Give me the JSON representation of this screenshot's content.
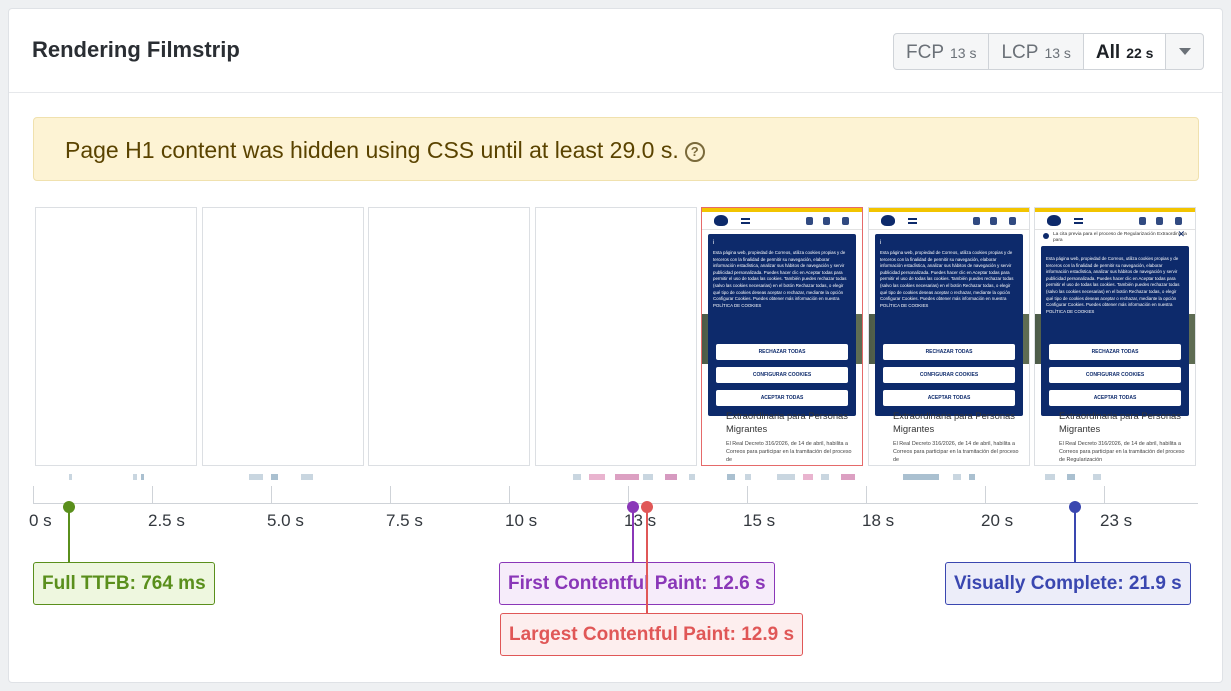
{
  "header": {
    "title": "Rendering Filmstrip"
  },
  "filter": {
    "options": [
      {
        "label": "FCP",
        "value": "13 s"
      },
      {
        "label": "LCP",
        "value": "13 s"
      },
      {
        "label": "All",
        "value": "22 s"
      }
    ],
    "selected": "All"
  },
  "warning": {
    "text": "Page H1 content was hidden using CSS until at least 29.0 s."
  },
  "frames": {
    "modal_text": "Esta página web, propiedad de Correos, utiliza cookies propias y de terceros con la finalidad de permitir su navegación, elaborar información estadística, analizar sus hábitos de navegación y servir publicidad personalizada. Puedes hacer clic en Aceptar todas para permitir el uso de todas las cookies. También puedes rechazar todas (salvo las cookies necesarias) en el botón Rechazar todas, o elegir qué tipo de cookies deseas aceptar o rechazar, mediante la opción Configurar Cookies. Puedes obtener más información en nuestra POLÍTICA DE COOKIES",
    "btn_reject": "RECHAZAR TODAS",
    "btn_config": "CONFIGURAR COOKIES",
    "btn_accept": "ACEPTAR TODAS",
    "heading": "Extraordinaria para Personas Migrantes",
    "paragraph": "El Real Decreto 316/2026, de 14 de abril, habilita a Correos para participar en la tramitación del proceso de",
    "paragraph_last": "El Real Decreto 316/2026, de 14 de abril, habilita a Correos para participar en la tramitación del proceso de Regularización",
    "cita_text": "La cita previa para el proceso de Regularización Extraordinaria para"
  },
  "axis": {
    "ticks": [
      "0 s",
      "2.5 s",
      "5.0 s",
      "7.5 s",
      "10 s",
      "13 s",
      "15 s",
      "18 s",
      "20 s",
      "23 s"
    ]
  },
  "markers": [
    {
      "key": "ttfb",
      "label": "Full TTFB: 764 ms",
      "time_s": 0.764,
      "color": "#5a8f1c",
      "bg": "#eef7df"
    },
    {
      "key": "fcp",
      "label": "First Contentful Paint: 12.6 s",
      "time_s": 12.6,
      "color": "#8a37b8",
      "bg": "#f6ecfa"
    },
    {
      "key": "lcp",
      "label": "Largest Contentful Paint: 12.9 s",
      "time_s": 12.9,
      "color": "#e05757",
      "bg": "#fdeeee"
    },
    {
      "key": "vc",
      "label": "Visually Complete: 21.9 s",
      "time_s": 21.9,
      "color": "#3a47b0",
      "bg": "#ecedf9"
    }
  ],
  "colors": {
    "accent_yellow": "#f2c400",
    "brand_blue": "#0d2a6b"
  }
}
